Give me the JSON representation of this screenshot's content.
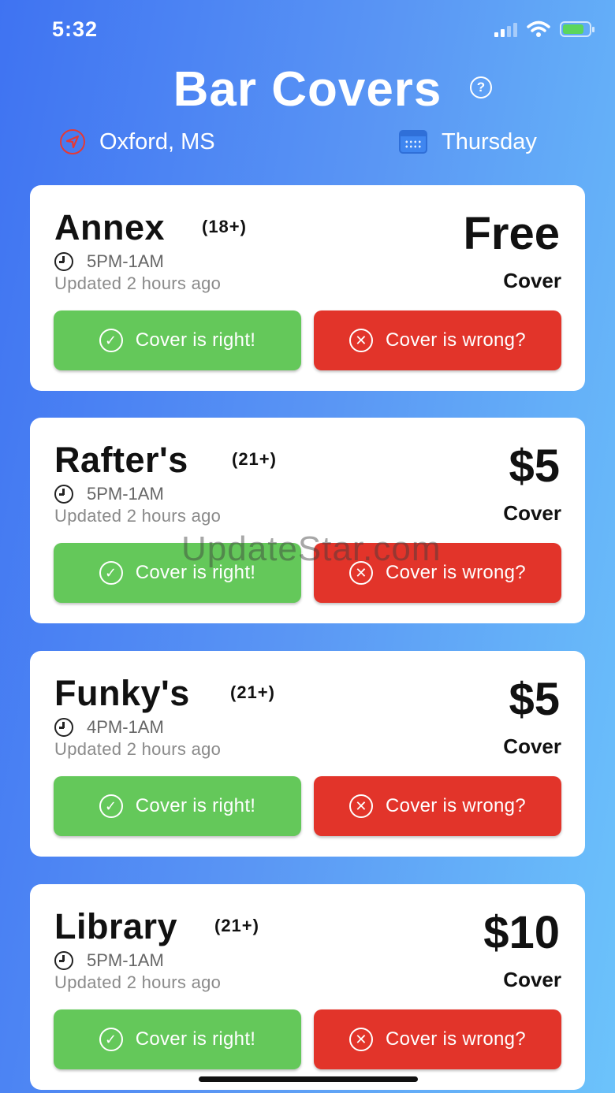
{
  "status_bar": {
    "time": "5:32"
  },
  "header": {
    "title": "Bar Covers"
  },
  "meta": {
    "location": "Oxford, MS",
    "day": "Thursday"
  },
  "bars": [
    {
      "name": "Annex",
      "age": "(18+)",
      "hours": "5PM-1AM",
      "updated": "Updated 2 hours ago",
      "price": "Free",
      "cover_label": "Cover",
      "right_label": "Cover is right!",
      "wrong_label": "Cover is wrong?"
    },
    {
      "name": "Rafter's",
      "age": "(21+)",
      "hours": "5PM-1AM",
      "updated": "Updated 2 hours ago",
      "price": "$5",
      "cover_label": "Cover",
      "right_label": "Cover is right!",
      "wrong_label": "Cover is wrong?"
    },
    {
      "name": "Funky's",
      "age": "(21+)",
      "hours": "4PM-1AM",
      "updated": "Updated 2 hours ago",
      "price": "$5",
      "cover_label": "Cover",
      "right_label": "Cover is right!",
      "wrong_label": "Cover is wrong?"
    },
    {
      "name": "Library",
      "age": "(21+)",
      "hours": "5PM-1AM",
      "updated": "Updated 2 hours ago",
      "price": "$10",
      "cover_label": "Cover",
      "right_label": "Cover is right!",
      "wrong_label": "Cover is wrong?"
    }
  ],
  "watermark": "UpdateStar.com",
  "colors": {
    "right_button": "#64c85a",
    "wrong_button": "#e2342a",
    "location_icon": "#e53935"
  }
}
